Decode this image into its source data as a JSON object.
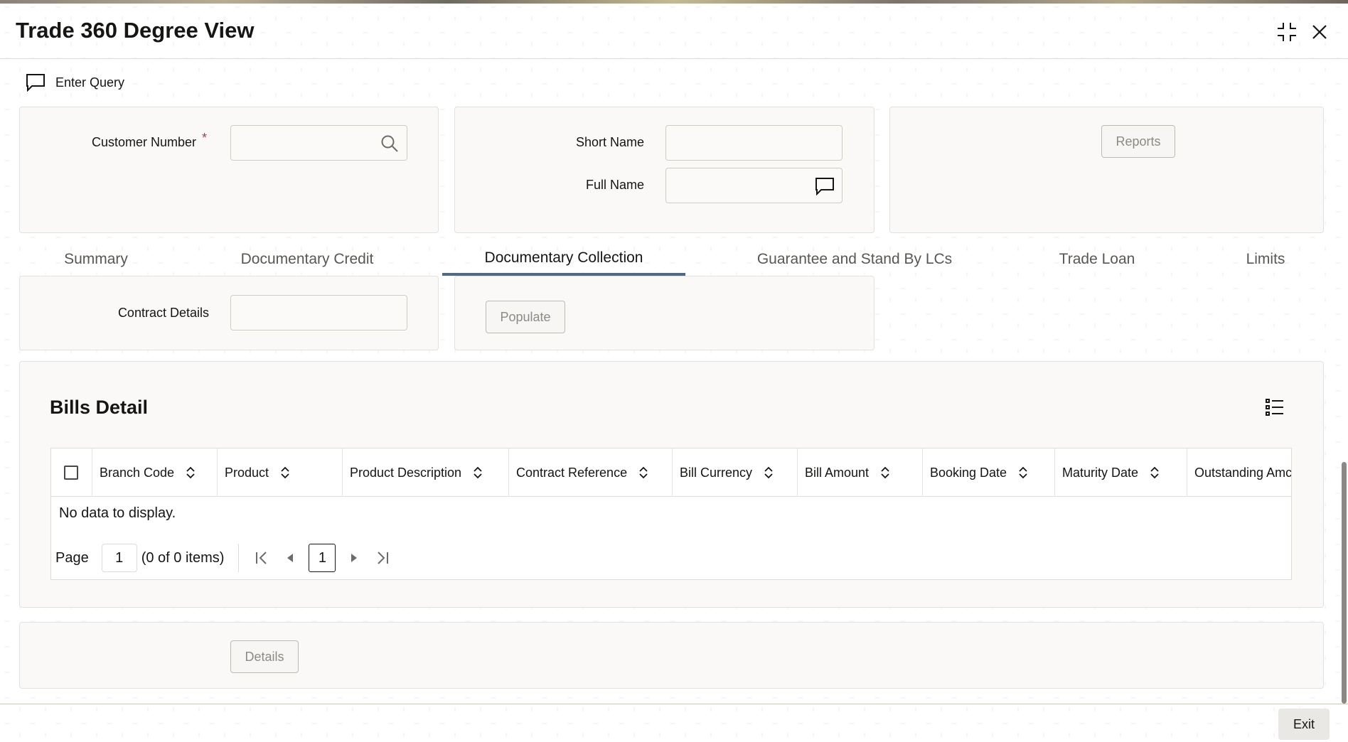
{
  "window": {
    "title": "Trade 360 Degree View",
    "compress_icon": "compress-icon",
    "close_icon": "close-icon"
  },
  "toolbar": {
    "enter_query_label": "Enter Query",
    "enter_query_icon": "comment-icon"
  },
  "header_fields": {
    "customer_number_label": "Customer Number",
    "customer_number_required": "*",
    "customer_number_value": "",
    "short_name_label": "Short Name",
    "short_name_value": "",
    "full_name_label": "Full Name",
    "full_name_value": "",
    "reports_label": "Reports"
  },
  "tabs": [
    {
      "label": "Summary",
      "active": false
    },
    {
      "label": "Documentary Credit",
      "active": false
    },
    {
      "label": "Documentary Collection",
      "active": true
    },
    {
      "label": "Guarantee and Stand By LCs",
      "active": false
    },
    {
      "label": "Trade Loan",
      "active": false
    },
    {
      "label": "Limits",
      "active": false
    }
  ],
  "collection": {
    "contract_details_label": "Contract Details",
    "contract_details_value": "",
    "populate_label": "Populate"
  },
  "bills_detail": {
    "title": "Bills Detail",
    "columns": [
      "Branch Code",
      "Product",
      "Product Description",
      "Contract Reference",
      "Bill Currency",
      "Bill Amount",
      "Booking Date",
      "Maturity Date",
      "Outstanding Amc"
    ],
    "rows": [],
    "empty_message": "No data to display.",
    "pager": {
      "page_label": "Page",
      "page_value": "1",
      "items_text": "(0 of 0 items)",
      "current_page": "1"
    }
  },
  "footer": {
    "details_label": "Details",
    "exit_label": "Exit"
  },
  "colors": {
    "active_tab_underline": "#4f6a85",
    "required_marker": "#b53a3a"
  }
}
